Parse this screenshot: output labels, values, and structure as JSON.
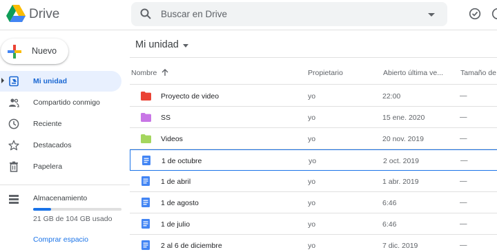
{
  "app": {
    "name": "Drive"
  },
  "search": {
    "placeholder": "Buscar en Drive"
  },
  "colors": {
    "accent": "#1a73e8",
    "active_bg": "#e8f0fe",
    "folder_red": "#ea4335",
    "folder_purple": "#c876e6",
    "folder_green": "#a4d65e",
    "doc_blue": "#4285f4"
  },
  "new_button": {
    "label": "Nuevo"
  },
  "sidebar": {
    "items": [
      {
        "label": "Mi unidad",
        "icon": "drive-icon",
        "active": true
      },
      {
        "label": "Compartido conmigo",
        "icon": "people-icon"
      },
      {
        "label": "Reciente",
        "icon": "clock-icon"
      },
      {
        "label": "Destacados",
        "icon": "star-icon"
      },
      {
        "label": "Papelera",
        "icon": "trash-icon"
      }
    ]
  },
  "storage": {
    "label": "Almacenamiento",
    "used_text": "21 GB de 104 GB usado",
    "used_fraction": 0.2,
    "buy_label": "Comprar espacio"
  },
  "main": {
    "title": "Mi unidad",
    "columns": [
      "Nombre",
      "Propietario",
      "Abierto última ve...",
      "Tamaño de a"
    ],
    "rows": [
      {
        "type": "folder",
        "color": "#ea4335",
        "name": "Proyecto de video",
        "owner": "yo",
        "opened": "22:00",
        "size": "—"
      },
      {
        "type": "folder",
        "color": "#c876e6",
        "name": "SS",
        "owner": "yo",
        "opened": "15 ene. 2020",
        "size": "—"
      },
      {
        "type": "folder",
        "color": "#a4d65e",
        "name": "Videos",
        "owner": "yo",
        "opened": "20 nov. 2019",
        "size": "—"
      },
      {
        "type": "doc",
        "name": "1 de octubre",
        "owner": "yo",
        "opened": "2 oct. 2019",
        "size": "—",
        "selected": true
      },
      {
        "type": "doc",
        "name": "1 de abril",
        "owner": "yo",
        "opened": "1 abr. 2019",
        "size": "—"
      },
      {
        "type": "doc",
        "name": "1 de agosto",
        "owner": "yo",
        "opened": "6:46",
        "size": "—"
      },
      {
        "type": "doc",
        "name": "1 de julio",
        "owner": "yo",
        "opened": "6:46",
        "size": "—"
      },
      {
        "type": "doc",
        "name": "2 al 6 de diciembre",
        "owner": "yo",
        "opened": "7 dic. 2019",
        "size": "—"
      }
    ]
  }
}
